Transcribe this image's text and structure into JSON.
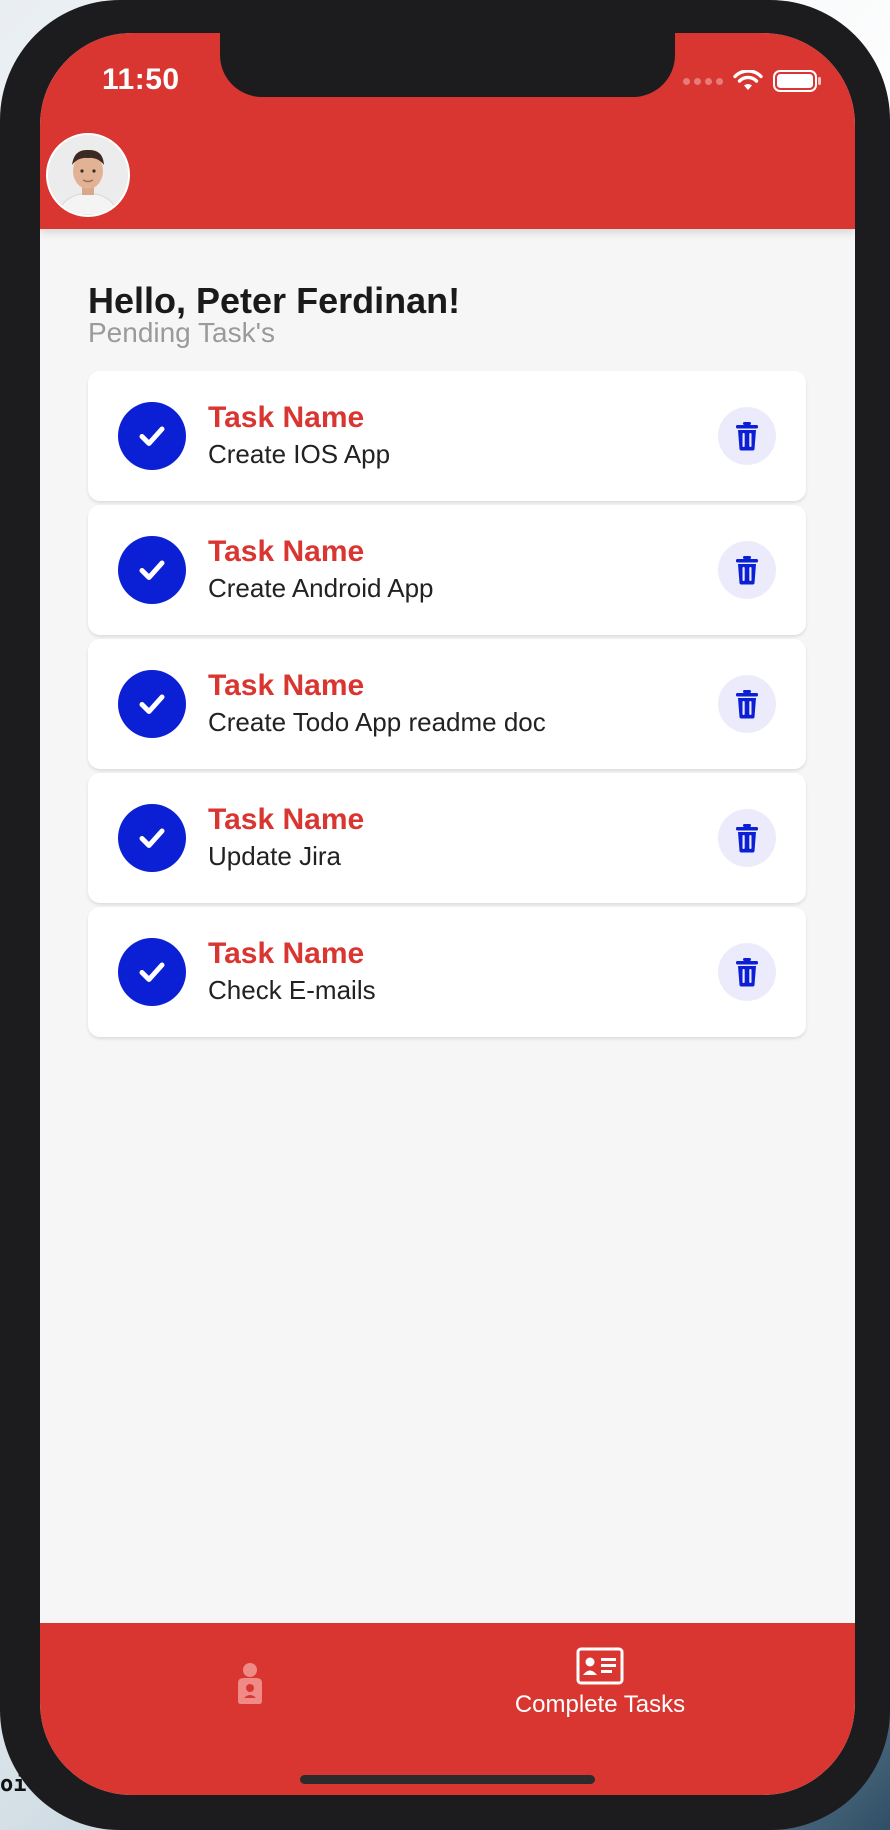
{
  "status_bar": {
    "time": "11:50"
  },
  "greeting": {
    "title": "Hello, Peter Ferdinan!",
    "subtitle": "Pending Task's"
  },
  "tasks": [
    {
      "title": "Task Name",
      "description": "Create IOS App"
    },
    {
      "title": "Task Name",
      "description": "Create Android App"
    },
    {
      "title": "Task Name",
      "description": "Create Todo App readme doc"
    },
    {
      "title": "Task Name",
      "description": "Update Jira"
    },
    {
      "title": "Task Name",
      "description": "Check E-mails"
    }
  ],
  "tabbar": {
    "pending_icon": "person-icon",
    "complete_label": "Complete Tasks",
    "complete_icon": "contact-card-icon"
  },
  "edge_text": "oi",
  "colors": {
    "header": "#d93632",
    "accent_blue": "#0b1fd4",
    "task_title": "#d93632",
    "background": "#f6f6f6"
  }
}
